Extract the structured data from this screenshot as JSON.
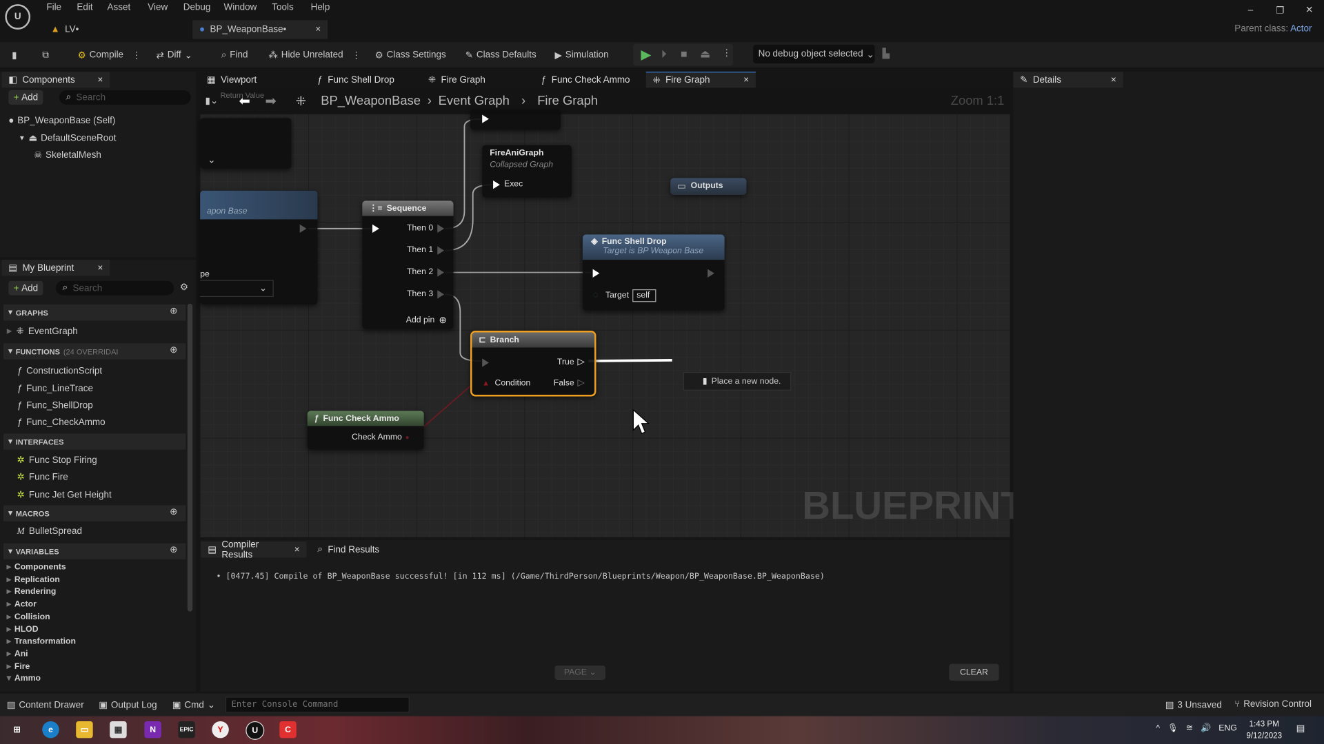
{
  "app": {
    "logo": "Unreal Engine",
    "parent_class_label": "Parent class:",
    "parent_class_value": "Actor"
  },
  "menu": [
    "File",
    "Edit",
    "Asset",
    "View",
    "Debug",
    "Window",
    "Tools",
    "Help"
  ],
  "doc_tabs": [
    {
      "label": "LV•"
    },
    {
      "label": "BP_WeaponBase•",
      "active": true
    }
  ],
  "toolbar": {
    "compile": "Compile",
    "diff": "Diff",
    "find": "Find",
    "hide_unrelated": "Hide Unrelated",
    "class_settings": "Class Settings",
    "class_defaults": "Class Defaults",
    "simulation": "Simulation",
    "debug_object": "No debug object selected",
    "play_color": "#5cb85c"
  },
  "components_panel": {
    "title": "Components",
    "add": "Add",
    "search_placeholder": "Search",
    "tree": [
      "BP_WeaponBase (Self)",
      "DefaultSceneRoot",
      "SkeletalMesh"
    ]
  },
  "my_blueprint": {
    "title": "My Blueprint",
    "add": "Add",
    "search_placeholder": "Search",
    "graphs": {
      "header": "GRAPHS",
      "items": [
        "EventGraph"
      ]
    },
    "functions": {
      "header": "FUNCTIONS",
      "note": "(24 OVERRIDAI",
      "items": [
        "ConstructionScript",
        "Func_LineTrace",
        "Func_ShellDrop",
        "Func_CheckAmmo"
      ]
    },
    "interfaces": {
      "header": "INTERFACES",
      "items": [
        "Func Stop Firing",
        "Func Fire",
        "Func Jet Get Height"
      ]
    },
    "macros": {
      "header": "MACROS",
      "items": [
        "BulletSpread"
      ]
    },
    "variables": {
      "header": "VARIABLES",
      "items": [
        "Components",
        "Replication",
        "Rendering",
        "Actor",
        "Collision",
        "HLOD",
        "Transformation",
        "Ani",
        "Fire",
        "Ammo"
      ]
    }
  },
  "graph_tabs": [
    "Viewport",
    "Func Shell Drop",
    "Fire Graph",
    "Func Check Ammo",
    "Fire Graph"
  ],
  "breadcrumb": {
    "items": [
      "BP_WeaponBase",
      "Event Graph",
      "Fire Graph"
    ],
    "zoom": "Zoom 1:1",
    "ghost": "Return Value"
  },
  "nodes": {
    "left_partial": {
      "subtitle": "apon Base",
      "label": "pe"
    },
    "sequence": {
      "title": "Sequence",
      "pins": [
        "Then 0",
        "Then 1",
        "Then 2",
        "Then 3"
      ],
      "add_pin": "Add pin"
    },
    "fire_ani": {
      "title": "FireAniGraph",
      "subtitle": "Collapsed Graph",
      "pin": "Exec"
    },
    "outputs": {
      "title": "Outputs"
    },
    "shell_drop": {
      "title": "Func Shell Drop",
      "subtitle": "Target is BP Weapon Base",
      "target_label": "Target",
      "target_value": "self"
    },
    "branch": {
      "title": "Branch",
      "true": "True",
      "false": "False",
      "condition": "Condition",
      "selected_color": "#f0a020"
    },
    "check_ammo": {
      "title": "Func Check Ammo",
      "pin": "Check Ammo"
    }
  },
  "tooltip": "Place a new node.",
  "watermark": "BLUEPRINT",
  "results": {
    "tabs": [
      "Compiler Results",
      "Find Results"
    ],
    "log": "[0477.45] Compile of BP_WeaponBase successful! [in 112 ms] (/Game/ThirdPerson/Blueprints/Weapon/BP_WeaponBase.BP_WeaponBase)",
    "page": "PAGE",
    "clear": "CLEAR"
  },
  "details": {
    "title": "Details"
  },
  "status_bar": {
    "content_drawer": "Content Drawer",
    "output_log": "Output Log",
    "cmd": "Cmd",
    "console_placeholder": "Enter Console Command",
    "unsaved": "3 Unsaved",
    "revision": "Revision Control"
  },
  "taskbar": {
    "lang": "ENG",
    "time": "1:43 PM",
    "date": "9/12/2023"
  }
}
